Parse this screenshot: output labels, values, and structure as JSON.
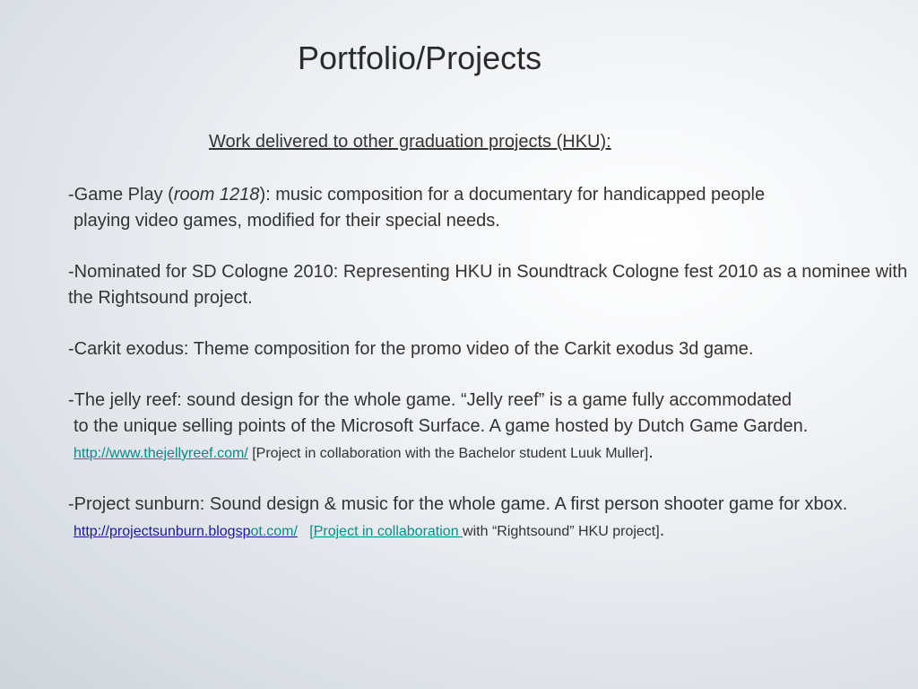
{
  "slide": {
    "title": "Portfolio/Projects",
    "subtitle": "Work delivered to other graduation projects (HKU):",
    "p1": {
      "prefix": "-Game Play (",
      "italic": "room 1218",
      "rest": "): music composition for a documentary for handicapped people",
      "line2": "playing video games, modified for their special needs."
    },
    "p2": "-Nominated for SD Cologne 2010: Representing HKU in Soundtrack Cologne fest 2010 as a nominee with the Rightsound project.",
    "p3": "-Carkit exodus: Theme composition for the promo video of the Carkit exodus 3d game.",
    "p4": {
      "line1": "-The jelly reef: sound design for the whole game.  “Jelly reef” is a game fully accommodated",
      "line2": "to the unique selling points of the Microsoft Surface. A game hosted by Dutch Game Garden.",
      "link": "http://www.thejellyreef.com/",
      "note": "[Project in collaboration with the Bachelor student Luuk Muller]",
      "end": "."
    },
    "p5": {
      "line1": "-Project sunburn: Sound design & music for the whole game. A first person shooter game for xbox.",
      "link_a": "http://projectsunburn.blogsp",
      "link_b": "ot.com/",
      "link_c": "[Project in collaboration ",
      "tail": "with “Rightsound” HKU project]",
      "end": "."
    }
  }
}
